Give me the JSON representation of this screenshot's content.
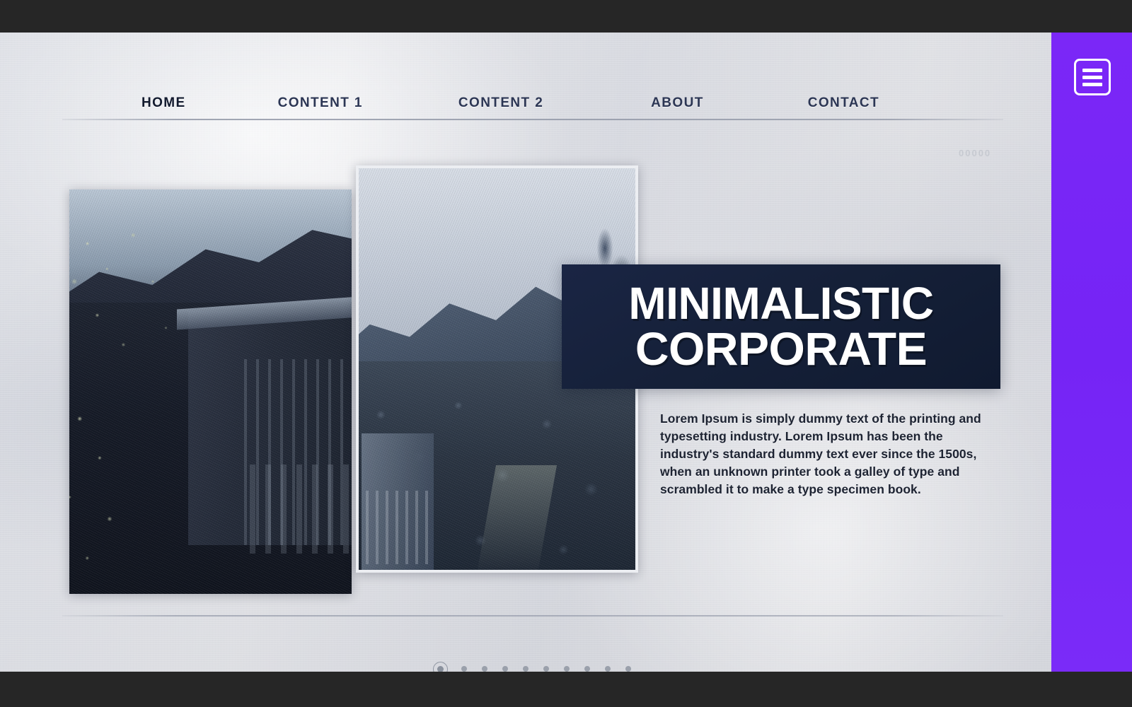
{
  "colors": {
    "frame": "#262626",
    "sidebar_accent": "#7b27f7",
    "title_block": "#152038",
    "nav_text": "#2c3654",
    "body_text": "#1d2332"
  },
  "sidebar": {
    "menu_button_label": "Menu",
    "menu_icon": "hamburger-icon"
  },
  "nav": {
    "items": [
      {
        "label": "HOME",
        "active": true
      },
      {
        "label": "CONTENT 1",
        "active": false
      },
      {
        "label": "CONTENT 2",
        "active": false
      },
      {
        "label": "ABOUT",
        "active": false
      },
      {
        "label": "CONTACT",
        "active": false
      }
    ]
  },
  "hero": {
    "title_line_1": "MINIMALISTIC",
    "title_line_2": "CORPORATE",
    "paragraph": "Lorem Ipsum is simply dummy text of the printing and typesetting industry. Lorem Ipsum has been the industry's standard dummy text ever since the 1500s, when an unknown printer took a galley of type and scrambled it to make a type specimen book.",
    "images": [
      {
        "name": "photo-left",
        "alt": "Dark manor house surrounded by trees"
      },
      {
        "name": "photo-right",
        "alt": "Forested valley with bright sky"
      }
    ],
    "watermark": "00000"
  },
  "pagination": {
    "total": 10,
    "active_index": 1,
    "dots": [
      1,
      2,
      3,
      4,
      5,
      6,
      7,
      8,
      9,
      10
    ]
  }
}
